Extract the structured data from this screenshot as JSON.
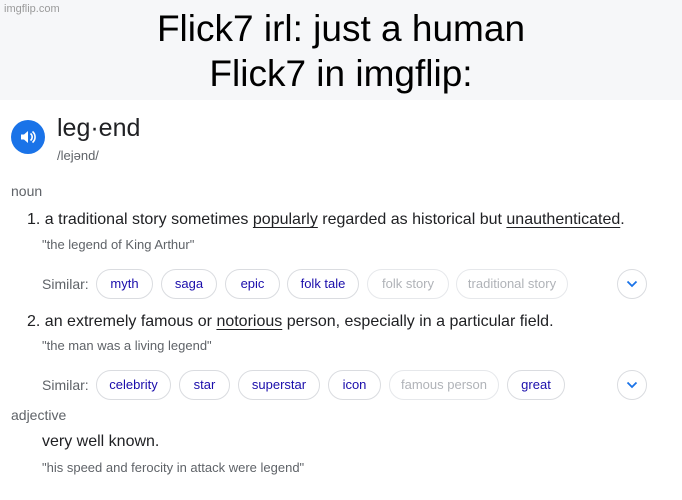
{
  "meme": {
    "watermark": "imgflip.com",
    "caption_line1": "Flick7 irl: just a human",
    "caption_line2": "Flick7 in imgflip:"
  },
  "dictionary": {
    "word": "leg·end",
    "phonetic": "/lejənd/",
    "icons": {
      "pronounce": "speaker-icon",
      "expand": "chevron-down-icon"
    },
    "accent_color": "#1a73e8",
    "noun": {
      "label": "noun",
      "senses": [
        {
          "number": "1.",
          "def_a": "a traditional story sometimes",
          "def_link1": "popularly",
          "def_b": "regarded as historical but",
          "def_link2": "unauthenticated",
          "def_c": ".",
          "example": "\"the legend of King Arthur\"",
          "similar_label": "Similar:",
          "similar": [
            "myth",
            "saga",
            "epic",
            "folk tale",
            "folk story",
            "traditional story"
          ]
        },
        {
          "number": "2.",
          "def_a": "an extremely famous or",
          "def_link1": "notorious",
          "def_b": "person, especially in a particular field.",
          "example": "\"the man was a living legend\"",
          "similar_label": "Similar:",
          "similar": [
            "celebrity",
            "star",
            "superstar",
            "icon",
            "famous person",
            "great"
          ]
        }
      ]
    },
    "adjective": {
      "label": "adjective",
      "definition": "very well known.",
      "example": "\"his speed and ferocity in attack were legend\""
    }
  }
}
